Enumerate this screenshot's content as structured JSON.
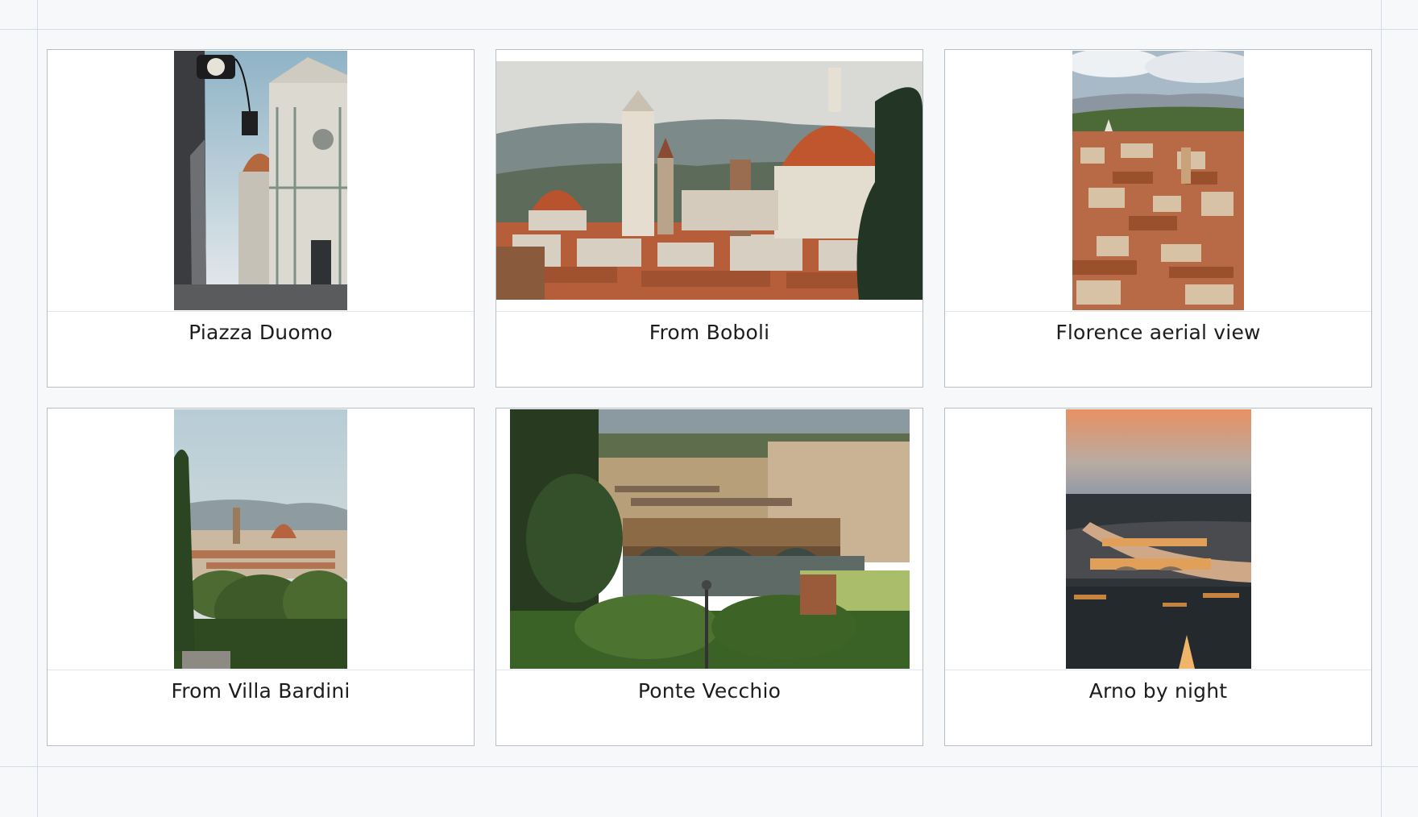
{
  "gallery": {
    "items": [
      {
        "caption": "Piazza Duomo",
        "photo": "duomo-facade-street-photo"
      },
      {
        "caption": "From Boboli",
        "photo": "duomo-skyline-photo"
      },
      {
        "caption": "Florence aerial view",
        "photo": "aerial-rooftops-photo"
      },
      {
        "caption": "From Villa Bardini",
        "photo": "villa-bardini-view-photo"
      },
      {
        "caption": "Ponte Vecchio",
        "photo": "ponte-vecchio-photo"
      },
      {
        "caption": "Arno by night",
        "photo": "arno-dusk-photo"
      }
    ]
  },
  "colors": {
    "page_background": "#f7f8fa",
    "card_border": "#b9bec6",
    "guide_lines": "#d6dbea",
    "caption_text": "#1d1d1f"
  }
}
